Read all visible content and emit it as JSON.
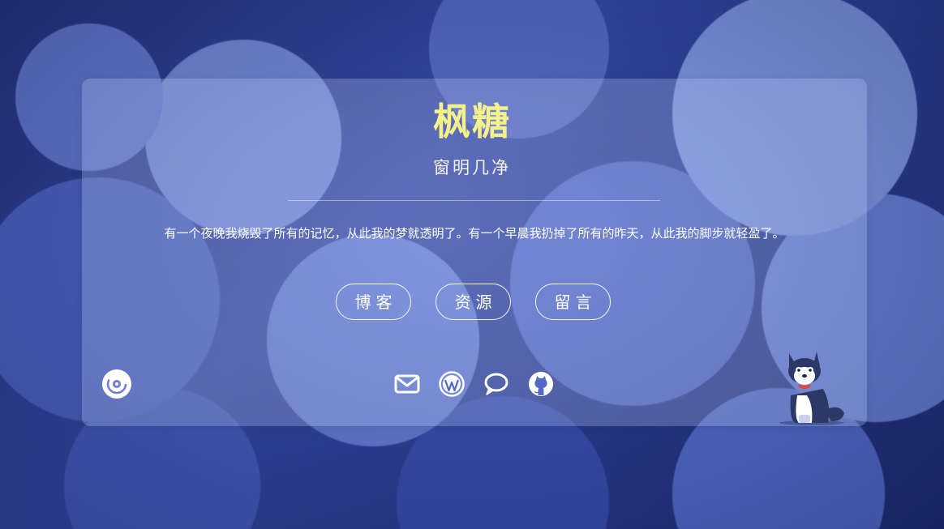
{
  "site": {
    "title": "枫糖",
    "subtitle": "窗明几净",
    "quote": "有一个夜晚我烧毁了所有的记忆，从此我的梦就透明了。有一个早晨我扔掉了所有的昨天，从此我的脚步就轻盈了。"
  },
  "nav": [
    {
      "label": "博客"
    },
    {
      "label": "资源"
    },
    {
      "label": "留言"
    }
  ],
  "icons": {
    "music": "music-disc-icon",
    "mail": "mail-icon",
    "wordpress": "wordpress-icon",
    "chat": "chat-bubble-icon",
    "github": "github-icon",
    "mascot": "husky-dog-mascot"
  },
  "colors": {
    "title": "#f4f08a",
    "text": "#ffffff",
    "card": "rgba(190,205,250,0.28)",
    "background": "#3a4ca8"
  }
}
